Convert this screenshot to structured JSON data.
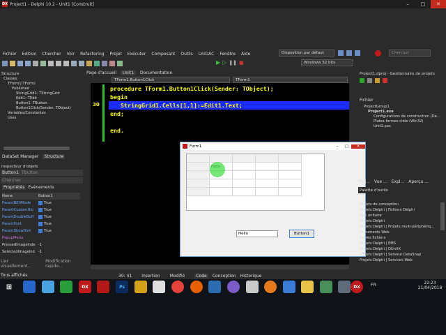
{
  "window": {
    "title": "Project1 - Delphi 10.2 - Unit1 [Construit]",
    "app_icon": "DX"
  },
  "menu": [
    "Fichier",
    "Edition",
    "Chercher",
    "Voir",
    "Refactoring",
    "Projet",
    "Exécuter",
    "Composant",
    "Outils",
    "UniDAC",
    "Fenêtre",
    "Aide"
  ],
  "toolbar": {
    "layout_combo": "Disposition par défaut",
    "search_placeholder": "Chercher",
    "platform": "Windows 32 bits"
  },
  "structure": {
    "header": "Structure",
    "tree": [
      "Classes",
      "TForm1(TForm)",
      "Published",
      "StringGrid1: TStringGrid",
      "Edit1: TEdit",
      "Button1: TButton",
      "Button1Click(Sender: TObject)",
      "Variables/Constantes",
      "Uses"
    ]
  },
  "left_tabs": {
    "datasets": "DataSet Manager",
    "structure": "Structure"
  },
  "inspector": {
    "header": "Inspecteur d'objets",
    "selected": "Button1",
    "selected_type": "TButton",
    "search": "Chercher",
    "tabs": [
      "Propriétés",
      "Evénements"
    ],
    "columns": [
      "Name",
      "Button1"
    ],
    "rows": [
      {
        "name": "ParentBiDiMode",
        "value": "True"
      },
      {
        "name": "ParentCustomHin",
        "value": "True"
      },
      {
        "name": "ParentDoubleBuff",
        "value": "True"
      },
      {
        "name": "ParentFont",
        "value": "True"
      },
      {
        "name": "ParentShowHint",
        "value": "True"
      },
      {
        "name": "PopupMenu",
        "value": ""
      },
      {
        "name": "PressedImageInde",
        "value": "-1"
      },
      {
        "name": "SelectedImageInd",
        "value": "-1"
      }
    ],
    "footer_left": "Lier visuellement...",
    "footer_right": "Modification rapide...",
    "status": "Tous affichés"
  },
  "editor": {
    "tabs": [
      "Page d'accueil",
      "Unit1",
      "Documentation"
    ],
    "method_combo": "TForm1.Button1Click",
    "class_combo": "TForm1",
    "line_number": "30",
    "lines": [
      "procedure TForm1.Button1Click(Sender: TObject);",
      "begin",
      "   StringGrid1.Cells[1,1]:=Edit1.Text;",
      "end;",
      "",
      "end."
    ],
    "status_pos": "30: 41",
    "status_mode": "Insertion",
    "status_modified": "Modifié",
    "bottom_tabs": [
      "Code",
      "Conception",
      "Historique"
    ]
  },
  "form": {
    "title": "Form1",
    "edit_value": "Hello",
    "button_label": "Button1",
    "grid_cell": "Hello"
  },
  "project": {
    "header": "Project1.dproj - Gestionnaire de projets",
    "file_label": "Fichier",
    "tree": [
      "ProjectGroup1",
      "Project1.exe",
      "Configurations de construction (De...",
      "Plates-formes cible (Win32)",
      "Unit1.pas"
    ]
  },
  "palette": {
    "header": "Palette d'outils",
    "tabs": [
      "Proj...",
      "Vue ...",
      "Expl...",
      "Aperçu ..."
    ],
    "items": [
      "Projets de conception",
      "Projets Delphi | Fichiers Delphi",
      "Test unitaire",
      "Projets Delphi",
      "Projets Delphi | Projets multi-périphériq...",
      "Documents Web",
      "Autres fichiers",
      "Projets Delphi | EMS",
      "Projets Delphi | DUnitX",
      "Projets Delphi | Serveur DataSnap",
      "Projets Delphi | Services Web"
    ]
  },
  "taskbar": {
    "lang": "FR",
    "time": "22:23",
    "date": "21/04/2018"
  },
  "colors": {
    "keyword": "#ffff00",
    "highlight": "#1a2cff",
    "accent": "#c21a1a"
  }
}
